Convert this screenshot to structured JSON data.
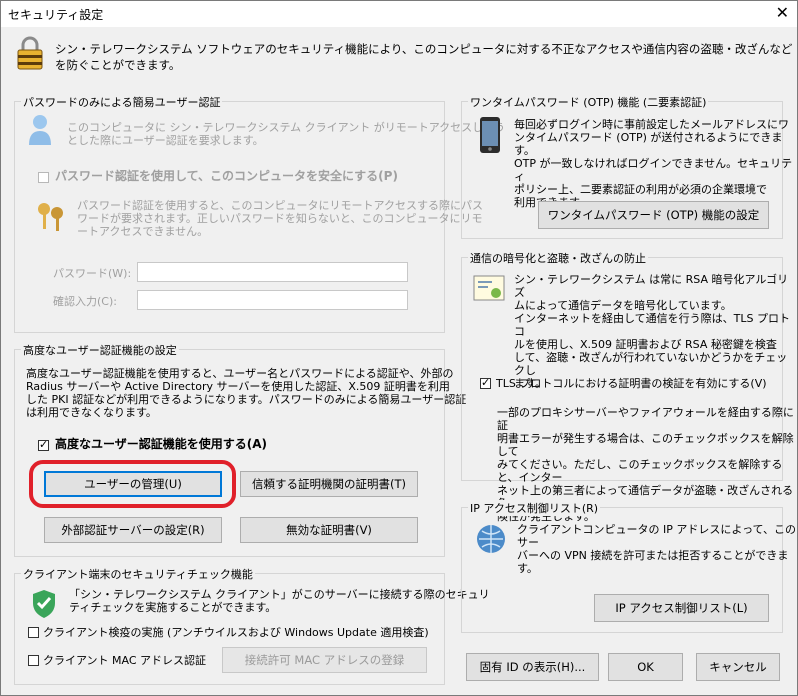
{
  "window": {
    "title": "セキュリティ設定",
    "close_glyph": "✕"
  },
  "intro": "シン・テレワークシステム ソフトウェアのセキュリティ機能により、このコンピュータに対する不正なアクセスや通信内容の盗聴・改ざんなどを防ぐことができます。",
  "password_group": {
    "legend": "パスワードのみによる簡易ユーザー認証",
    "desc": "このコンピュータに シン・テレワークシステム クライアント がリモートアクセスしよう\nとした際にユーザー認証を要求します。",
    "checkbox_label": "パスワード認証を使用して、このコンピュータを安全にする(P)",
    "detail": "パスワード認証を使用すると、このコンピュータにリモートアクセスする際にパス\nワードが要求されます。正しいパスワードを知らないと、このコンピュータにリモ\nートアクセスできません。",
    "password_label": "パスワード(W):",
    "confirm_label": "確認入力(C):",
    "password_value": "",
    "confirm_value": ""
  },
  "advanced_group": {
    "legend": "高度なユーザー認証機能の設定",
    "desc": "高度なユーザー認証機能を使用すると、ユーザー名とパスワードによる認証や、外部の\nRadius サーバーや Active Directory サーバーを使用した認証、X.509 証明書を利用\nした PKI 認証などが利用できるようになります。パスワードのみによる簡易ユーザー認証\nは利用できなくなります。",
    "checkbox_label": "高度なユーザー認証機能を使用する(A)",
    "checked": true,
    "btn_user_mgmt": "ユーザーの管理(U)",
    "btn_trusted_ca": "信頼する証明機関の証明書(T)",
    "btn_external_server": "外部認証サーバーの設定(R)",
    "btn_invalid_cert": "無効な証明書(V)"
  },
  "client_group": {
    "legend": "クライアント端末のセキュリティチェック機能",
    "desc": "「シン・テレワークシステム クライアント」がこのサーバーに接続する際のセキュリ\nティチェックを実施することができます。",
    "chk_inspection": "クライアント検疫の実施 (アンチウイルスおよび Windows Update 適用検査)",
    "chk_mac": "クライアント MAC アドレス認証",
    "btn_mac_register": "接続許可 MAC アドレスの登録"
  },
  "otp_group": {
    "legend": "ワンタイムパスワード (OTP) 機能 (二要素認証)",
    "desc": "毎回必ずログイン時に事前設定したメールアドレスにワ\nンタイムパスワード (OTP) が送付されるようにできます。\nOTP が一致しなければログインできません。セキュリティ\nポリシー上、二要素認証の利用が必須の企業環境で\n利用できます。",
    "btn_otp": "ワンタイムパスワード (OTP) 機能の設定"
  },
  "encryption_group": {
    "legend": "通信の暗号化と盗聴・改ざんの防止",
    "desc": "シン・テレワークシステム は常に RSA 暗号化アルゴリズ\nムによって通信データを暗号化しています。\nインターネットを経由して通信を行う際は、TLS プロトコ\nルを使用し、X.509 証明書および RSA 秘密鍵を検査\nして、盗聴・改ざんが行われていないかどうかをチェックし\nます。",
    "checkbox_label": "TLS プロトコルにおける証明書の検証を有効にする(V)",
    "checked": true,
    "note": "一部のプロキシサーバーやファイアウォールを経由する際に証\n明書エラーが発生する場合は、このチェックボックスを解除して\nみてください。ただし、このチェックボックスを解除すると、インター\nネット上の第三者によって通信データが盗聴・改ざんされる危\n険性が発生します。"
  },
  "ip_group": {
    "legend": "IP アクセス制御リスト(R)",
    "desc": "クライアントコンピュータの IP アドレスによって、このサー\nバーへの VPN 接続を許可または拒否することができま\nす。",
    "btn_ip": "IP アクセス制御リスト(L)"
  },
  "footer": {
    "btn_id": "固有 ID の表示(H)...",
    "btn_ok": "OK",
    "btn_cancel": "キャンセル"
  },
  "colors": {
    "highlight_ring": "#e0202a",
    "focus_border": "#0078d7"
  }
}
